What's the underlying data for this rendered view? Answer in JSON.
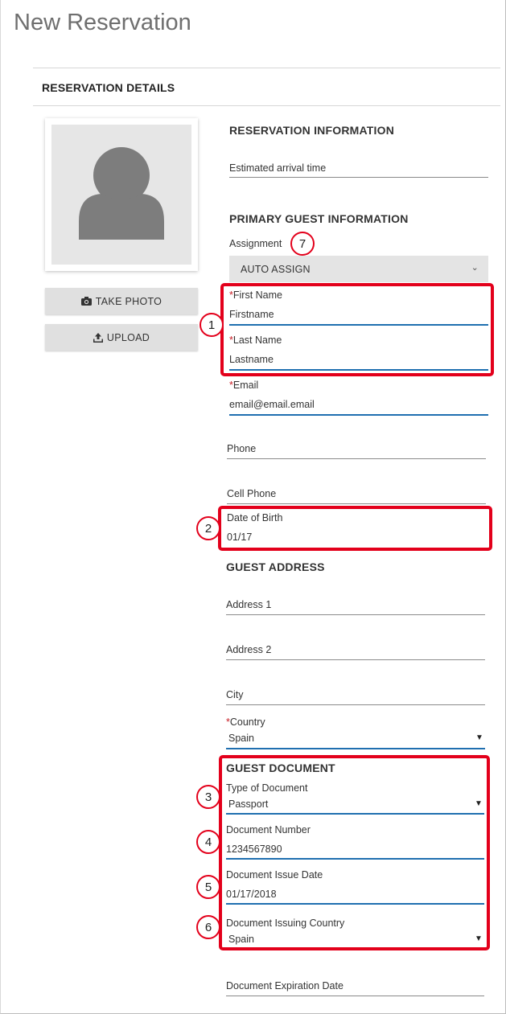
{
  "page": {
    "title": "New Reservation"
  },
  "section": {
    "title": "RESERVATION DETAILS"
  },
  "photo": {
    "take_photo_label": "TAKE PHOTO",
    "upload_label": "UPLOAD",
    "icons": {
      "avatar": "user-silhouette-icon",
      "camera": "camera-icon",
      "upload": "upload-icon"
    }
  },
  "reservation_info": {
    "title": "RESERVATION INFORMATION",
    "arrival_label": "Estimated arrival time"
  },
  "primary_guest": {
    "title": "PRIMARY GUEST INFORMATION",
    "assignment_label": "Assignment",
    "assignment_value": "AUTO ASSIGN",
    "required_mark": "*",
    "first_name_label": "First Name",
    "first_name_value": "Firstname",
    "last_name_label": "Last Name",
    "last_name_value": "Lastname",
    "email_label": "Email",
    "email_value": "email@email.email",
    "phone_label": "Phone",
    "cell_phone_label": "Cell Phone",
    "dob_label": "Date of Birth",
    "dob_value": "01/17"
  },
  "guest_address": {
    "title": "GUEST ADDRESS",
    "address1_label": "Address 1",
    "address2_label": "Address 2",
    "city_label": "City",
    "country_label": "Country",
    "country_value": "Spain"
  },
  "guest_document": {
    "title": "GUEST DOCUMENT",
    "type_label": "Type of Document",
    "type_value": "Passport",
    "number_label": "Document Number",
    "number_value": "1234567890",
    "issue_date_label": "Document Issue Date",
    "issue_date_value": "01/17/2018",
    "issuing_country_label": "Document Issuing Country",
    "issuing_country_value": "Spain",
    "expiration_label": "Document Expiration Date"
  },
  "annotations": {
    "color": "#e3001b",
    "badges": [
      "1",
      "2",
      "3",
      "4",
      "5",
      "6",
      "7"
    ]
  },
  "colors": {
    "accent": "#1f6fb0",
    "required": "#c81d25"
  }
}
